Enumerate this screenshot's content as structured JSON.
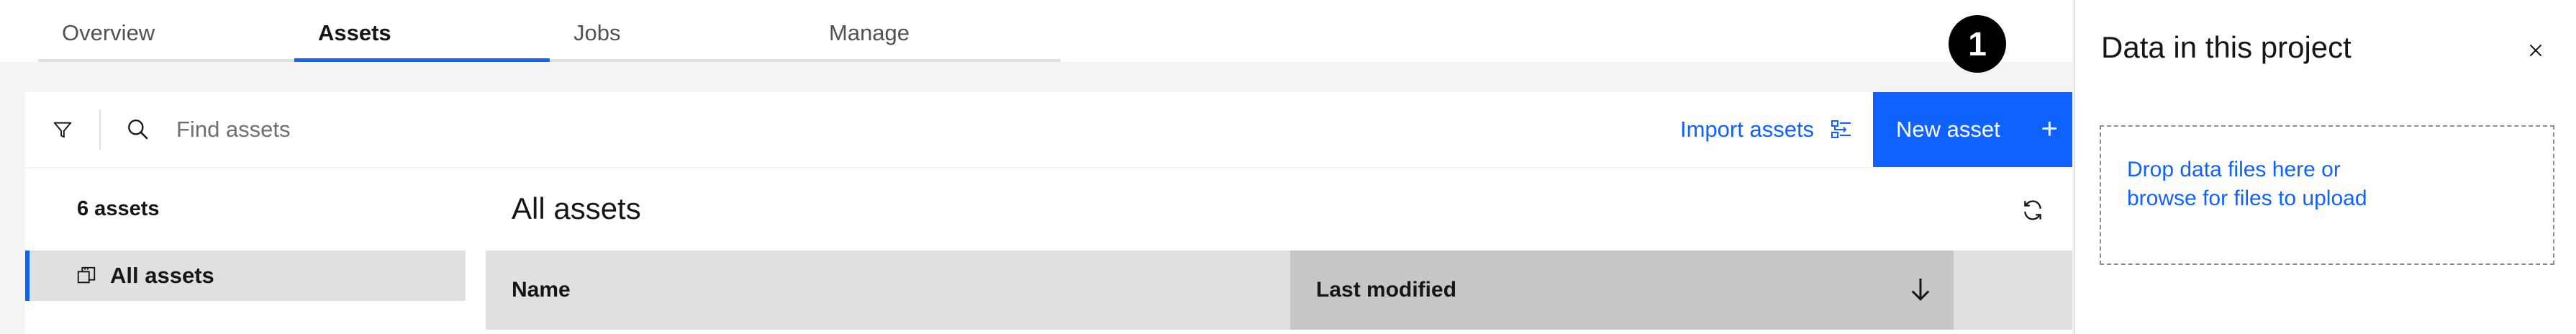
{
  "tabs": [
    {
      "label": "Overview",
      "active": false
    },
    {
      "label": "Assets",
      "active": true
    },
    {
      "label": "Jobs",
      "active": false
    },
    {
      "label": "Manage",
      "active": false
    }
  ],
  "badge": {
    "number": "1"
  },
  "toolbar": {
    "filter_icon": "filter-icon",
    "search_icon": "search-icon",
    "search_placeholder": "Find assets",
    "search_value": "",
    "import_label": "Import assets",
    "import_icon": "import-icon",
    "new_asset_label": "New asset",
    "new_asset_icon": "+"
  },
  "sidebar": {
    "count_label": "6 assets",
    "all_assets_label": "All assets",
    "all_assets_icon": "copy-icon"
  },
  "main": {
    "title": "All assets",
    "refresh_icon": "refresh-icon",
    "columns": [
      {
        "label": "Name",
        "sorted": false
      },
      {
        "label": "Last modified",
        "sorted": true,
        "direction": "descending"
      }
    ]
  },
  "side_panel": {
    "title": "Data in this project",
    "close_icon": "×",
    "drop_line1": "Drop data files here or",
    "drop_line2": "browse for files to upload"
  },
  "colors": {
    "accent": "#0f62fe",
    "selected_bg": "#e0e0e0",
    "sorted_header_bg": "#c6c6c6",
    "page_bg": "#f4f4f4"
  }
}
